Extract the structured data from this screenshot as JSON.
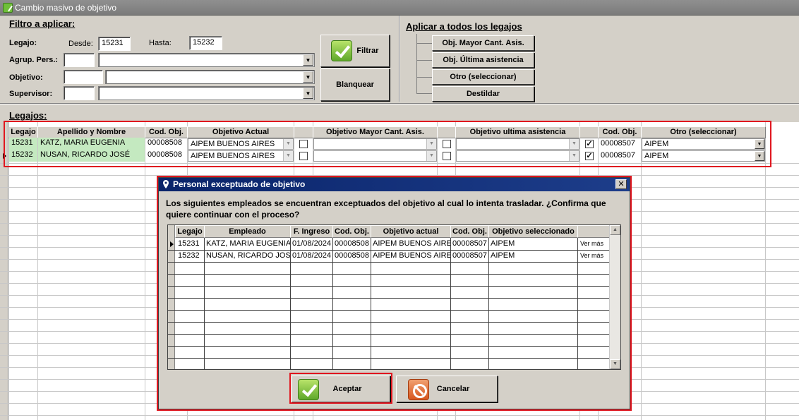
{
  "window": {
    "title": "Cambio masivo de objetivo"
  },
  "filter": {
    "section_title": "Filtro a aplicar:",
    "legajo_label": "Legajo:",
    "desde_label": "Desde:",
    "desde_value": "15231",
    "hasta_label": "Hasta:",
    "hasta_value": "15232",
    "agrup_label": "Agrup. Pers.:",
    "objetivo_label": "Objetivo:",
    "supervisor_label": "Supervisor:",
    "filtrar_label": "Filtrar",
    "blanquear_label": "Blanquear"
  },
  "apply_all": {
    "section_title": "Aplicar a todos los legajos",
    "buttons": [
      "Obj. Mayor Cant. Asis.",
      "Obj. Última asistencia",
      "Otro (seleccionar)",
      "Destildar"
    ]
  },
  "legajos": {
    "section_title": "Legajos:",
    "headers": [
      "Legajo",
      "Apellido y Nombre",
      "Cod. Obj.",
      "Objetivo Actual",
      "",
      "Objetivo Mayor Cant. Asis.",
      "",
      "Objetivo ultima asistencia",
      "",
      "Cod. Obj.",
      "Otro (seleccionar)"
    ],
    "rows": [
      {
        "legajo": "15231",
        "nombre": "KATZ, MARIA EUGENIA",
        "cod_obj": "00008508",
        "objetivo_actual": "AIPEM BUENOS AIRES",
        "chk_mayor": false,
        "chk_ultima": false,
        "chk_otro": true,
        "cod_obj_otro": "00008507",
        "otro": "AIPEM"
      },
      {
        "legajo": "15232",
        "nombre": "NUSAN, RICARDO JOSÉ",
        "cod_obj": "00008508",
        "objetivo_actual": "AIPEM BUENOS AIRES",
        "chk_mayor": false,
        "chk_ultima": false,
        "chk_otro": true,
        "cod_obj_otro": "00008507",
        "otro": "AIPEM"
      }
    ]
  },
  "dialog": {
    "title": "Personal exceptuado de objetivo",
    "close_label": "✕",
    "message": "Los siguientes empleados se encuentran exceptuados del objetivo al cual lo intenta trasladar. ¿Confirma que quiere continuar con el proceso?",
    "headers": [
      "Legajo",
      "Empleado",
      "F. Ingreso",
      "Cod. Obj.",
      "Objetivo actual",
      "Cod. Obj.",
      "Objetivo seleccionado",
      ""
    ],
    "rows": [
      {
        "legajo": "15231",
        "empleado": "KATZ, MARIA EUGENIA",
        "f_ingreso": "01/08/2024",
        "cod_obj": "00008508",
        "objetivo_actual": "AIPEM BUENOS AIRES",
        "cod_obj_sel": "00008507",
        "objetivo_sel": "AIPEM",
        "ver_mas": "Ver más"
      },
      {
        "legajo": "15232",
        "empleado": "NUSAN, RICARDO JOSÉ",
        "f_ingreso": "01/08/2024",
        "cod_obj": "00008508",
        "objetivo_actual": "AIPEM BUENOS AIRES",
        "cod_obj_sel": "00008507",
        "objetivo_sel": "AIPEM",
        "ver_mas": "Ver más"
      }
    ],
    "aceptar_label": "Aceptar",
    "cancelar_label": "Cancelar"
  },
  "colors": {
    "highlight": "#e0161f",
    "selected_cell": "#c4e9c0",
    "dialog_title": "#0a246a"
  }
}
